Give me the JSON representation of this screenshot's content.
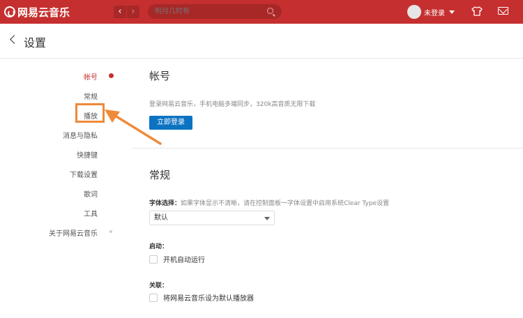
{
  "app": {
    "logo_text": "网易云音乐",
    "search_placeholder": "明月几时有",
    "user_label": "未登录"
  },
  "header": {
    "title": "设置"
  },
  "nav": {
    "items": [
      {
        "label": "帐号"
      },
      {
        "label": "常规"
      },
      {
        "label": "播放"
      },
      {
        "label": "消息与隐私"
      },
      {
        "label": "快捷键"
      },
      {
        "label": "下载设置"
      },
      {
        "label": "歌词"
      },
      {
        "label": "工具"
      },
      {
        "label": "关于网易云音乐"
      }
    ]
  },
  "account": {
    "title": "帐号",
    "desc": "登录网易云音乐，手机电脑多端同步，320k高音质无限下载",
    "login_button": "立即登录"
  },
  "general": {
    "title": "常规",
    "font_label": "字体选择：",
    "font_hint": "如果字体显示不清晰，请在控制面板一字体设置中启用系统Clear Type设置",
    "font_value": "默认",
    "startup_label": "启动：",
    "startup_option": "开机自动运行",
    "assoc_label": "关联：",
    "assoc_option": "将网易云音乐设为默认播放器"
  },
  "colors": {
    "brand": "#c62f2f",
    "login_button": "#0c73c2",
    "highlight": "#ee8a3a"
  }
}
